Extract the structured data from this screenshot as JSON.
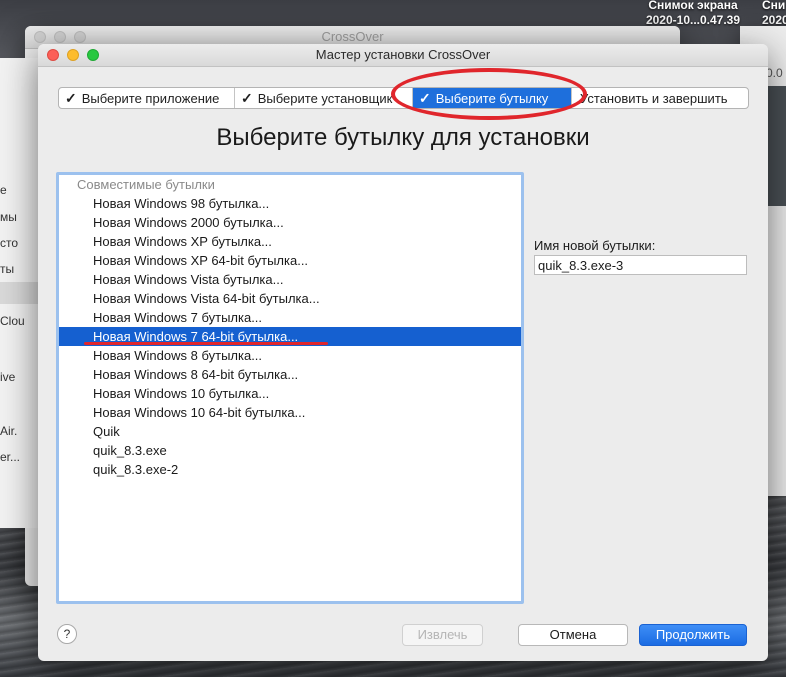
{
  "desktop": {
    "screenshot_label_1": "Снимок экрана",
    "screenshot_date_1": "2020-10...0.47.39",
    "screenshot_label_2": "Сни",
    "screenshot_date_2": "2020"
  },
  "back_window": {
    "title": "CrossOver",
    "side_items": [
      "е",
      "мы",
      "сто",
      "ты",
      "Clou",
      "ive",
      "Air.",
      "er..."
    ],
    "version_fragment": "0.0"
  },
  "dialog": {
    "title": "Мастер установки CrossOver",
    "steps": [
      {
        "label": "Выберите приложение",
        "checked": true,
        "active": false
      },
      {
        "label": "Выберите установщик",
        "checked": true,
        "active": false
      },
      {
        "label": "Выберите бутылку",
        "checked": true,
        "active": true
      },
      {
        "label": "Установить и завершить",
        "checked": false,
        "active": false
      }
    ],
    "check_glyph": "✓",
    "heading": "Выберите бутылку для установки",
    "list": {
      "group_header": "Совместимые бутылки",
      "items": [
        "Новая Windows 98 бутылка...",
        "Новая Windows 2000 бутылка...",
        "Новая Windows XP бутылка...",
        "Новая Windows XP 64-bit бутылка...",
        "Новая Windows Vista бутылка...",
        "Новая Windows Vista 64-bit бутылка...",
        "Новая Windows 7 бутылка...",
        "Новая Windows 7 64-bit бутылка...",
        "Новая Windows 8 бутылка...",
        "Новая Windows 8 64-bit бутылка...",
        "Новая Windows 10 бутылка...",
        "Новая Windows 10 64-bit бутылка...",
        "Quik",
        "quik_8.3.exe",
        "quik_8.3.exe-2"
      ],
      "selected_index": 7
    },
    "new_bottle_label": "Имя новой бутылки:",
    "new_bottle_value": "quik_8.3.exe-3",
    "help_label": "?",
    "extract_label": "Извлечь",
    "cancel_label": "Отмена",
    "next_label": "Продолжить"
  },
  "colors": {
    "accent": "#1e6fdc",
    "selection": "#1560d0",
    "annotation_red": "#e0262c"
  }
}
